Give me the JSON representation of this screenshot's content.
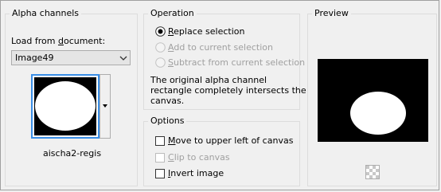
{
  "alpha_channels": {
    "title": "Alpha channels",
    "load_label_prefix": "Load from ",
    "load_label_underlined": "d",
    "load_label_suffix": "ocument:",
    "document_value": "Image49",
    "thumbnail_caption": "aischa2-regis"
  },
  "operation": {
    "title": "Operation",
    "replace": {
      "prefix": "",
      "underlined": "R",
      "suffix": "eplace selection",
      "selected": true
    },
    "add": {
      "prefix": "",
      "underlined": "A",
      "suffix": "dd to current selection",
      "selected": false,
      "disabled": true
    },
    "subtract": {
      "prefix": "",
      "underlined": "S",
      "suffix": "ubtract from current selection",
      "selected": false,
      "disabled": true
    },
    "info_line1": "The original alpha channel",
    "info_line2": "rectangle completely intersects the",
    "info_line3": "canvas."
  },
  "options": {
    "title": "Options",
    "move": {
      "prefix": "",
      "underlined": "M",
      "suffix": "ove to upper left of canvas",
      "checked": false
    },
    "clip": {
      "prefix": "",
      "underlined": "C",
      "suffix": "lip to canvas",
      "checked": false,
      "disabled": true
    },
    "invert": {
      "prefix": "",
      "underlined": "I",
      "suffix": "nvert image",
      "checked": false
    }
  },
  "preview": {
    "title": "Preview"
  },
  "colors": {
    "accent": "#3a8ee6",
    "disabled_text": "#a0a0a0"
  }
}
